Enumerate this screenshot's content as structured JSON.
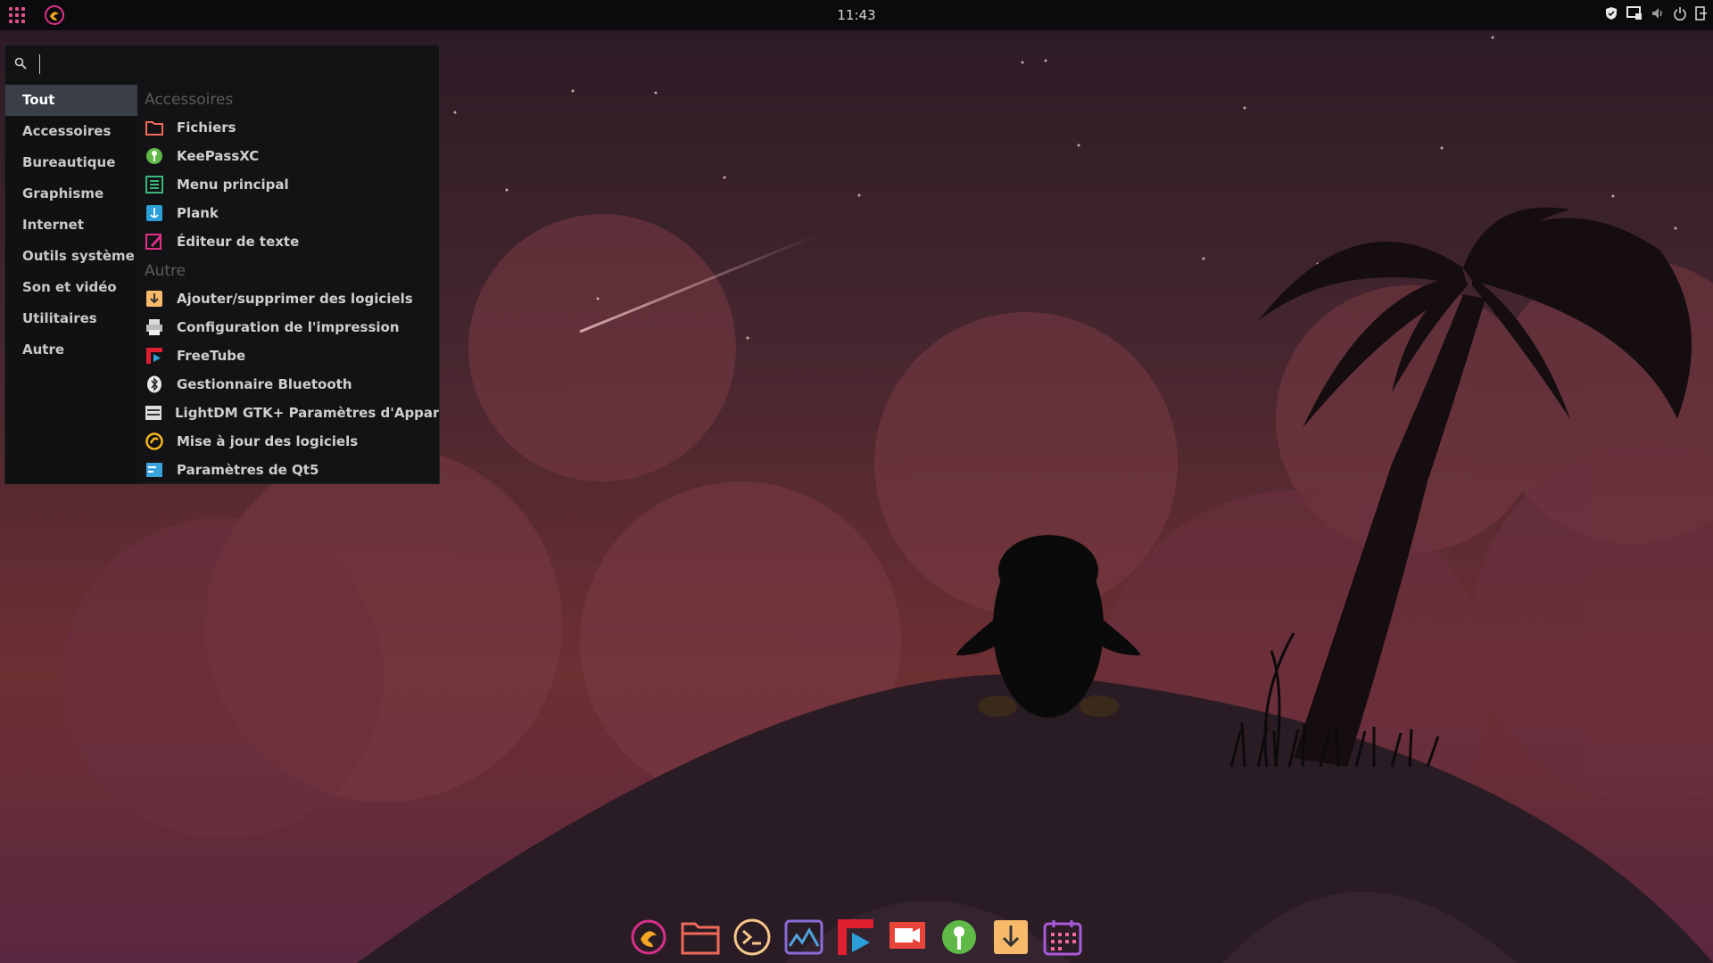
{
  "panel": {
    "clock": "11:43",
    "apps_icon": "apps-grid-icon",
    "logo_icon": "garuda-logo-icon",
    "tray": [
      "shield-icon",
      "notification-icon",
      "volume-icon",
      "power-icon",
      "logout-icon"
    ]
  },
  "menu": {
    "search": {
      "placeholder": "",
      "value": ""
    },
    "categories": [
      {
        "label": "Tout",
        "active": true
      },
      {
        "label": "Accessoires"
      },
      {
        "label": "Bureautique"
      },
      {
        "label": "Graphisme"
      },
      {
        "label": "Internet"
      },
      {
        "label": "Outils système"
      },
      {
        "label": "Son et vidéo"
      },
      {
        "label": "Utilitaires"
      },
      {
        "label": "Autre"
      }
    ],
    "sections": [
      {
        "title": "Accessoires",
        "apps": [
          {
            "label": "Fichiers",
            "icon": "folder-icon"
          },
          {
            "label": "KeePassXC",
            "icon": "keepassxc-icon"
          },
          {
            "label": "Menu principal",
            "icon": "menu-editor-icon"
          },
          {
            "label": "Plank",
            "icon": "plank-icon"
          },
          {
            "label": "Éditeur de texte",
            "icon": "text-editor-icon"
          }
        ]
      },
      {
        "title": "Autre",
        "apps": [
          {
            "label": "Ajouter/supprimer des logiciels",
            "icon": "software-install-icon"
          },
          {
            "label": "Configuration de l'impression",
            "icon": "printer-icon"
          },
          {
            "label": "FreeTube",
            "icon": "freetube-icon"
          },
          {
            "label": "Gestionnaire Bluetooth",
            "icon": "bluetooth-icon"
          },
          {
            "label": "LightDM GTK+ Paramètres d'Apparence",
            "icon": "lightdm-settings-icon"
          },
          {
            "label": "Mise à jour des logiciels",
            "icon": "software-update-icon"
          },
          {
            "label": "Paramètres de Qt5",
            "icon": "qt5-settings-icon"
          }
        ]
      }
    ]
  },
  "dock": [
    "garuda-logo-icon",
    "file-manager-icon",
    "terminal-icon",
    "system-monitor-icon",
    "freetube-icon",
    "screen-recorder-icon",
    "keepassxc-icon",
    "software-install-icon",
    "calendar-icon"
  ]
}
